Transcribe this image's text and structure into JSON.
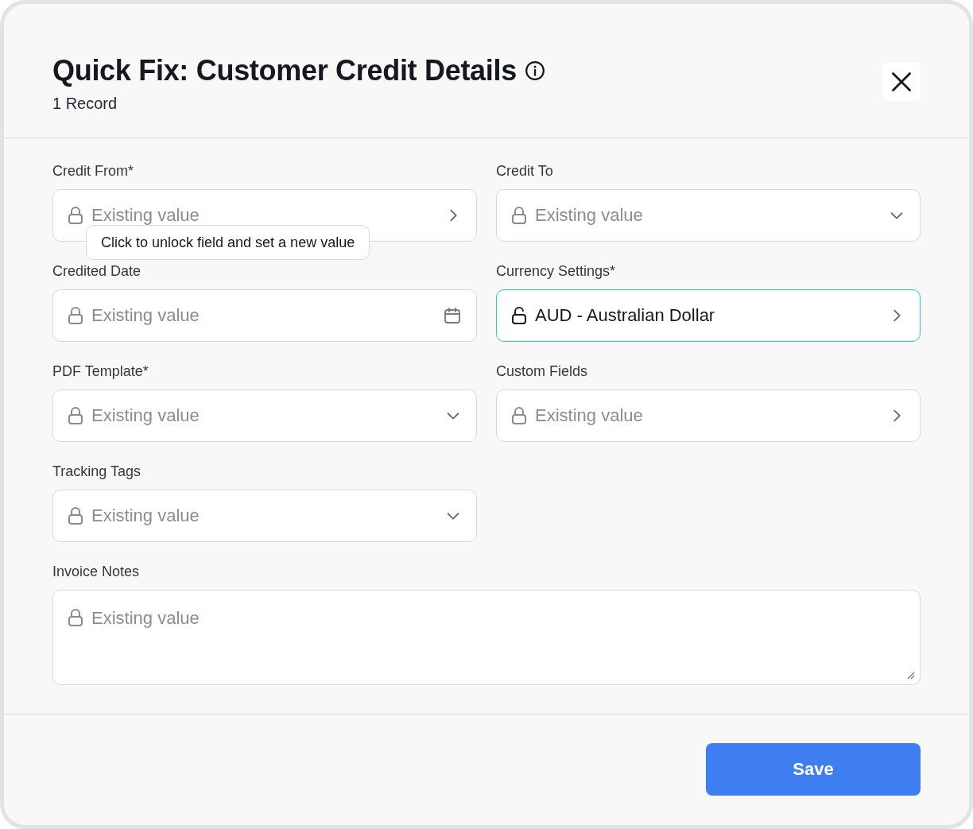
{
  "dialog": {
    "title": "Quick Fix: Customer Credit Details",
    "subtitle": "1 Record"
  },
  "fields": [
    {
      "label": "Credit From*",
      "kind": "chevron",
      "locked": true,
      "active": false,
      "placeholder": "Existing value",
      "tooltip": "Click to unlock field and set a new value"
    },
    {
      "label": "Credit To",
      "kind": "dropdown",
      "locked": true,
      "active": false,
      "placeholder": "Existing value"
    },
    {
      "label": "Credited Date",
      "kind": "date",
      "locked": true,
      "active": false,
      "placeholder": "Existing value"
    },
    {
      "label": "Currency Settings*",
      "kind": "chevron",
      "locked": false,
      "active": true,
      "value": "AUD - Australian Dollar"
    },
    {
      "label": "PDF Template*",
      "kind": "dropdown",
      "locked": true,
      "active": false,
      "placeholder": "Existing value"
    },
    {
      "label": "Custom Fields",
      "kind": "chevron",
      "locked": true,
      "active": false,
      "placeholder": "Existing value"
    },
    {
      "label": "Tracking Tags",
      "kind": "dropdown",
      "locked": true,
      "active": false,
      "placeholder": "Existing value"
    },
    {
      "label": "Invoice Notes",
      "kind": "textarea",
      "locked": true,
      "active": false,
      "placeholder": "Existing value"
    }
  ],
  "footer": {
    "save_button": "Save"
  }
}
